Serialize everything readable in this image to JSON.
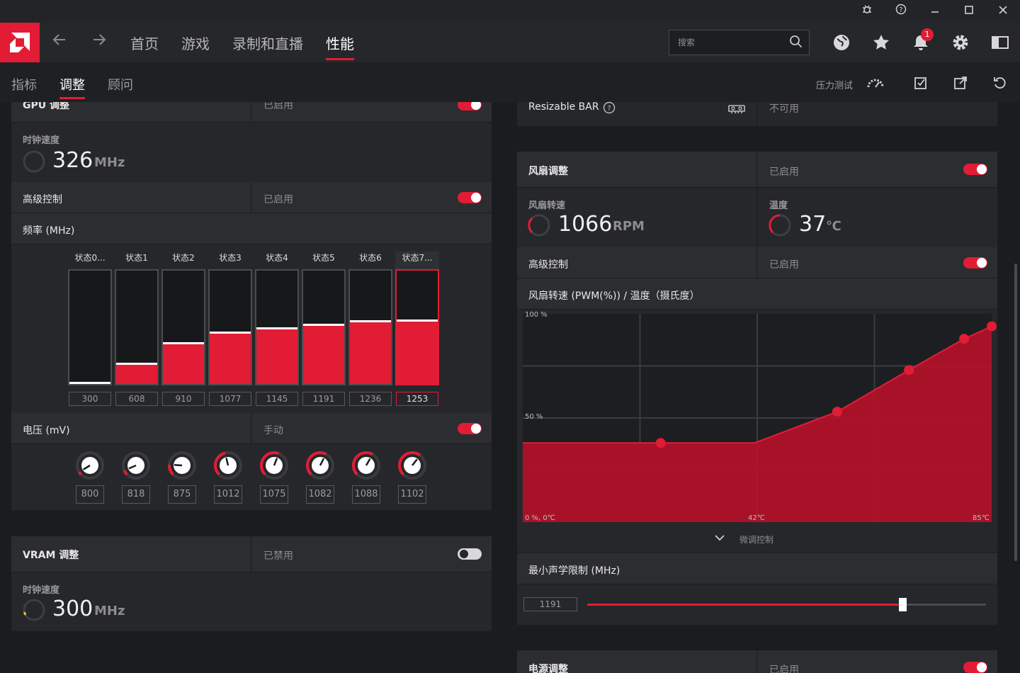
{
  "nav": {
    "tabs": [
      "首页",
      "游戏",
      "录制和直播",
      "性能"
    ],
    "search_placeholder": "搜索",
    "notification_count": "1"
  },
  "subnav": {
    "tabs": [
      "指标",
      "调整",
      "顾问"
    ],
    "stress_test": "压力测试"
  },
  "gpu": {
    "title": "GPU 调整",
    "state": "已启用",
    "clock_label": "时钟速度",
    "clock_value": "326",
    "clock_unit": "MHz",
    "adv_label": "高级控制",
    "adv_state": "已启用",
    "freq_label": "频率 (MHz)",
    "states": [
      "状态0...",
      "状态1",
      "状态2",
      "状态3",
      "状态4",
      "状态5",
      "状态6",
      "状态7..."
    ],
    "freqs": [
      "300",
      "608",
      "910",
      "1077",
      "1145",
      "1191",
      "1236",
      "1253"
    ],
    "freq_fraction": [
      0.02,
      0.19,
      0.37,
      0.46,
      0.5,
      0.53,
      0.56,
      0.57
    ],
    "volt_label": "电压 (mV)",
    "volt_state": "手动",
    "volts": [
      "800",
      "818",
      "875",
      "1012",
      "1075",
      "1082",
      "1088",
      "1102"
    ],
    "volt_fraction": [
      0.05,
      0.08,
      0.18,
      0.45,
      0.58,
      0.6,
      0.61,
      0.64
    ]
  },
  "vram": {
    "title": "VRAM 调整",
    "state": "已禁用",
    "clock_label": "时钟速度",
    "clock_value": "300",
    "clock_unit": "MHz"
  },
  "rbar": {
    "label": "Resizable BAR",
    "state": "不可用"
  },
  "fan": {
    "title": "风扇调整",
    "state": "已启用",
    "speed_label": "风扇转速",
    "speed_value": "1066",
    "speed_unit": "RPM",
    "temp_label": "温度",
    "temp_value": "37",
    "temp_unit": "℃",
    "adv_label": "高级控制",
    "adv_state": "已启用",
    "curve_label": "风扇转速 (PWM(%)) / 温度（摄氏度）",
    "finetune": "微调控制",
    "acoustic_label": "最小声学限制 (MHz)",
    "acoustic_value": "1191",
    "acoustic_fraction": 0.79
  },
  "power": {
    "title": "电源调整",
    "state": "已启用"
  },
  "chart_data": {
    "type": "area",
    "x_unit": "℃",
    "y_unit": "%",
    "x": [
      0,
      25,
      42,
      57,
      70,
      80,
      85
    ],
    "y": [
      38,
      38,
      38,
      53,
      73,
      88,
      94
    ],
    "xlim": [
      0,
      85
    ],
    "ylim": [
      0,
      100
    ],
    "x_tick_labels": [
      "0 %, 0℃",
      "42℃",
      "85℃"
    ],
    "y_tick_labels": [
      "100 %",
      "50 %"
    ],
    "grid": true,
    "fill_color": "#b8112a",
    "point_color": "#e21c35"
  },
  "colors": {
    "accent": "#e21c35",
    "panel": "#26272b",
    "header": "#2c2d31"
  }
}
